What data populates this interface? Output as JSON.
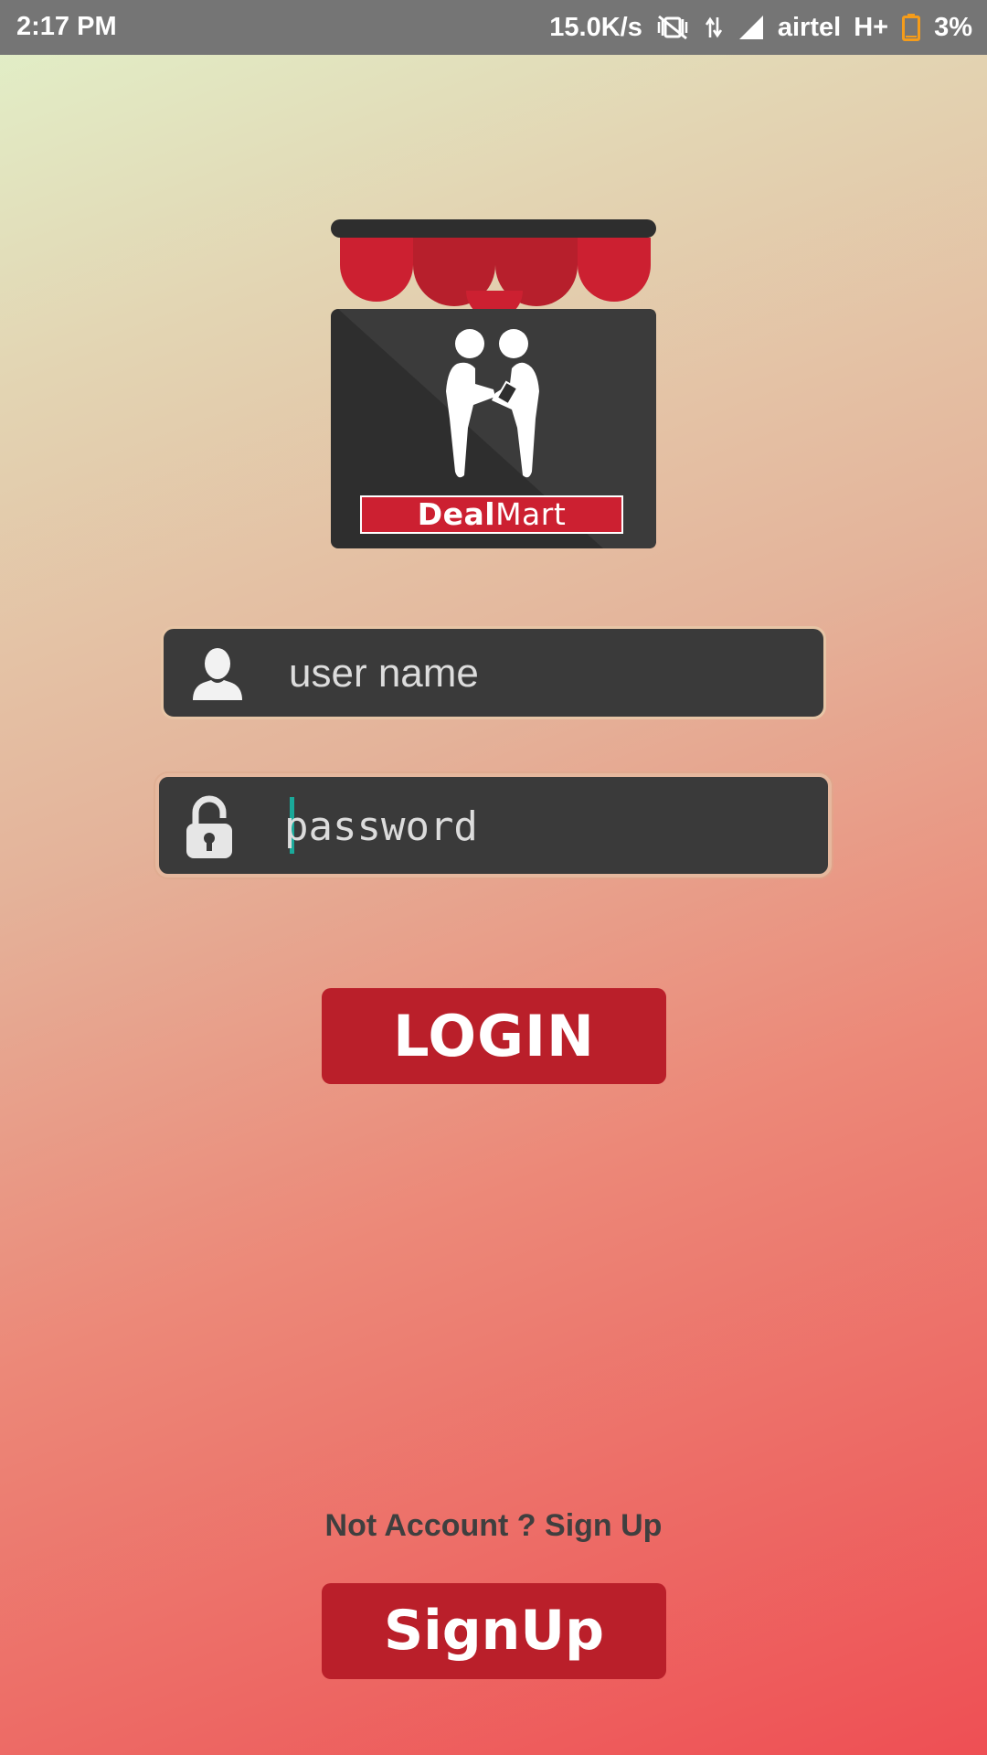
{
  "status_bar": {
    "time": "2:17 PM",
    "network_speed": "15.0K/s",
    "carrier": "airtel",
    "network_type": "H+",
    "battery": "3%",
    "icons": [
      "vibrate-off-icon",
      "data-transfer-icon",
      "signal-icon",
      "battery-low-icon"
    ],
    "battery_color": "#f59c1a"
  },
  "logo": {
    "brand_bold": "Deal",
    "brand_light": "Mart",
    "awning_color": "#cc2031",
    "panel_color": "#2e2e2e"
  },
  "form": {
    "username": {
      "placeholder": "user name",
      "value": "",
      "icon": "user-icon"
    },
    "password": {
      "placeholder": "password",
      "value": "",
      "icon": "unlock-icon",
      "caret_color": "#1aa99a"
    }
  },
  "buttons": {
    "login_label": "LOGIN",
    "signup_label": "SignUp",
    "color": "#ba1f2a"
  },
  "signup_hint": "Not Account ? Sign Up"
}
